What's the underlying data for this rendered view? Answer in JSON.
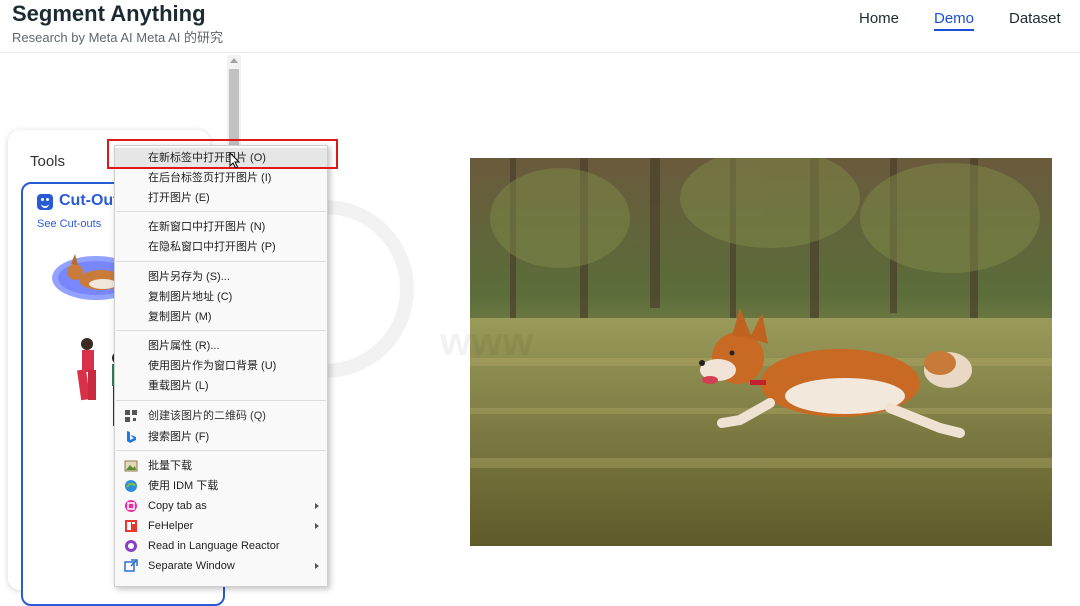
{
  "header": {
    "title": "Segment Anything",
    "subtitle": "Research by Meta AI Meta AI 的研究",
    "nav": [
      "Home",
      "Demo",
      "Dataset"
    ]
  },
  "tools": {
    "label": "Tools",
    "card_title": "Cut-Out",
    "card_link": "See Cut-outs"
  },
  "menu": {
    "items": [
      "在新标签中打开图片 (O)",
      "在后台标签页打开图片 (I)",
      "打开图片 (E)",
      "在新窗口中打开图片 (N)",
      "在隐私窗口中打开图片 (P)",
      "图片另存为 (S)...",
      "复制图片地址 (C)",
      "复制图片 (M)",
      "图片属性 (R)...",
      "使用图片作为窗口背景 (U)",
      "重载图片 (L)",
      "创建该图片的二维码 (Q)",
      "搜索图片 (F)",
      "批量下载",
      "使用 IDM 下载",
      "Copy tab as",
      "FeHelper",
      "Read in Language Reactor",
      "Separate Window"
    ]
  },
  "colors": {
    "accent": "#1a4fd6",
    "highlight_box": "#e01818"
  }
}
